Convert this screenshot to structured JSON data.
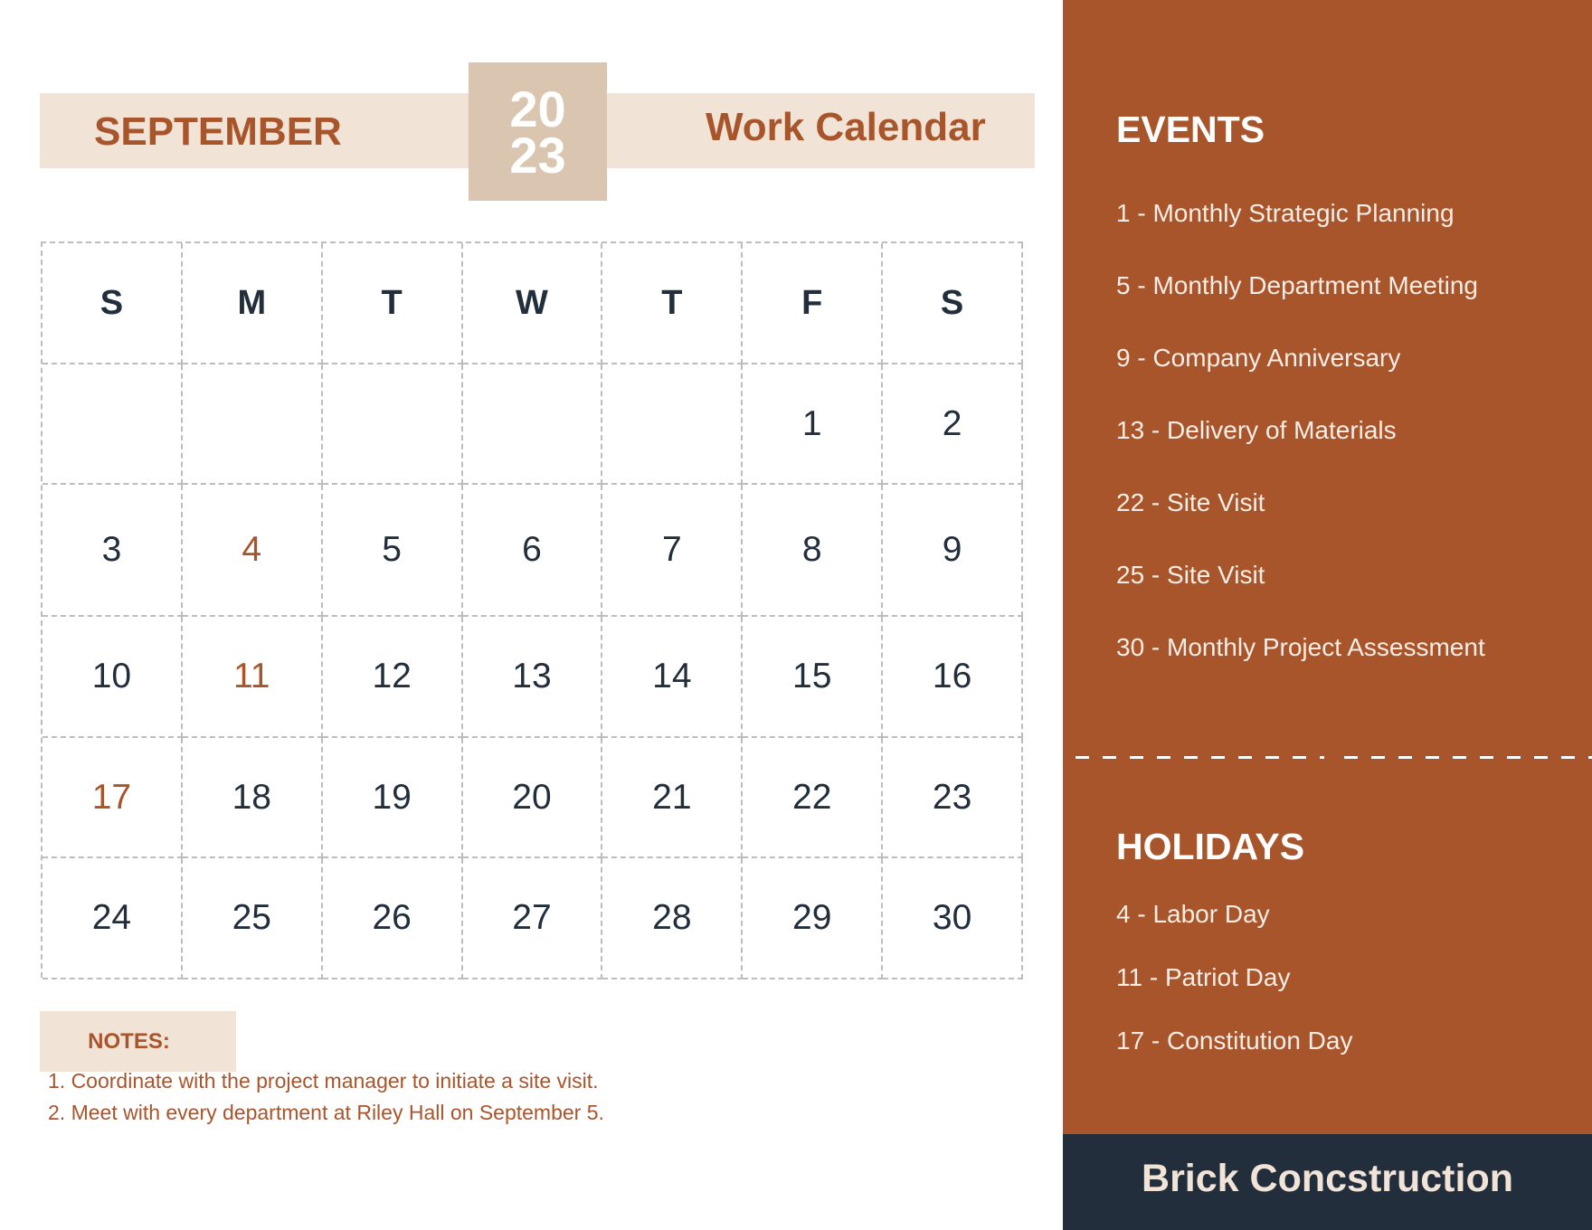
{
  "header": {
    "month": "SEPTEMBER",
    "year_top": "20",
    "year_bottom": "23",
    "title": "Work Calendar"
  },
  "calendar": {
    "weekdays": [
      "S",
      "M",
      "T",
      "W",
      "T",
      "F",
      "S"
    ],
    "weeks": [
      [
        "",
        "",
        "",
        "",
        "",
        "1",
        "2"
      ],
      [
        "3",
        "4",
        "5",
        "6",
        "7",
        "8",
        "9"
      ],
      [
        "10",
        "11",
        "12",
        "13",
        "14",
        "15",
        "16"
      ],
      [
        "17",
        "18",
        "19",
        "20",
        "21",
        "22",
        "23"
      ],
      [
        "24",
        "25",
        "26",
        "27",
        "28",
        "29",
        "30"
      ]
    ],
    "highlighted_days": [
      "4",
      "11",
      "17"
    ]
  },
  "notes": {
    "label": "NOTES:",
    "items": [
      "1. Coordinate with the project manager to initiate a site visit.",
      "2. Meet with every department at Riley Hall on September 5."
    ]
  },
  "events": {
    "heading": "EVENTS",
    "items": [
      "1 - Monthly Strategic Planning",
      "5 - Monthly Department Meeting",
      "9 - Company Anniversary",
      "13 - Delivery of Materials",
      "22 - Site Visit",
      "25 - Site Visit",
      "30 - Monthly Project Assessment"
    ]
  },
  "holidays": {
    "heading": "HOLIDAYS",
    "items": [
      "4 - Labor Day",
      "11 - Patriot Day",
      "17 - Constitution Day"
    ]
  },
  "footer": {
    "company": "Brick Concstruction"
  },
  "colors": {
    "accent": "#A8552C",
    "banner_bg": "#F1E3D6",
    "year_bg": "#D9C5B0",
    "text_dark": "#222E3C",
    "footer_bg": "#222E3C"
  }
}
